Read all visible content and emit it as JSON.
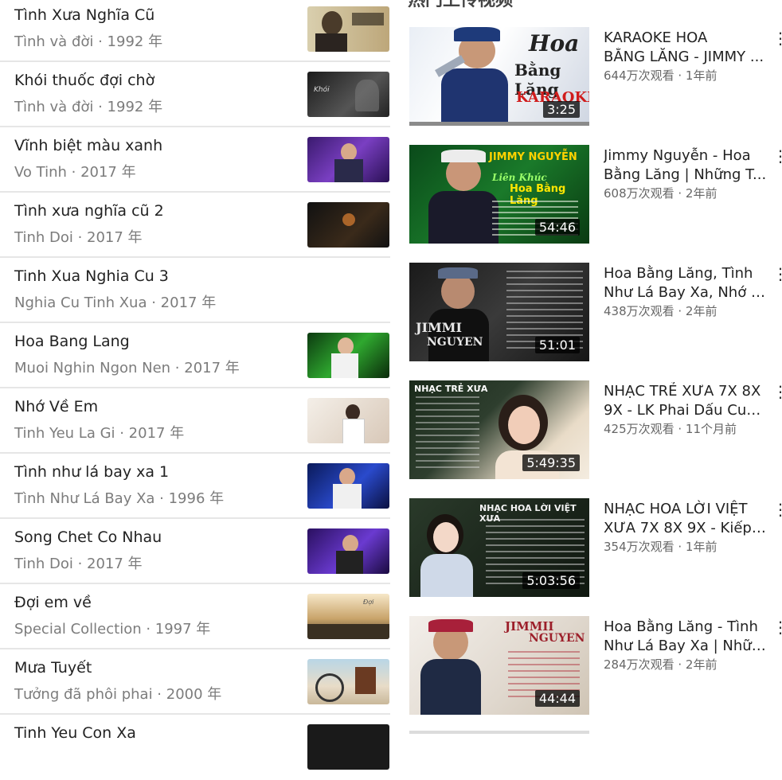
{
  "section_title": "热门上传视频",
  "songs": [
    {
      "title": "Tình Xưa Nghĩa Cũ",
      "subtitle": "Tình và đời · 1992 年",
      "thumb": "acoustic"
    },
    {
      "title": "Khói thuốc đợi chờ",
      "subtitle": "Tình và đời · 1992 年",
      "thumb": "dark-smoke"
    },
    {
      "title": "Vĩnh biệt màu xanh",
      "subtitle": "Vo Tinh · 2017 年",
      "thumb": "purple-stage"
    },
    {
      "title": "Tình xưa nghĩa cũ 2",
      "subtitle": "Tinh Doi · 2017 年",
      "thumb": "dark-club"
    },
    {
      "title": "Tinh Xua Nghia Cu 3",
      "subtitle": "Nghia Cu Tinh Xua · 2017 年",
      "thumb": ""
    },
    {
      "title": "Hoa Bang Lang",
      "subtitle": "Muoi Nghin Ngon Nen · 2017 年",
      "thumb": "green-stage"
    },
    {
      "title": "Nhớ Về Em",
      "subtitle": "Tinh Yeu La Gi · 2017 年",
      "thumb": "light-lady"
    },
    {
      "title": "Tình như lá bay xa 1",
      "subtitle": "Tình Như Lá Bay Xa · 1996 年",
      "thumb": "blue-stage"
    },
    {
      "title": "Song Chet Co Nhau",
      "subtitle": "Tinh Doi · 2017 年",
      "thumb": "violet-stage"
    },
    {
      "title": "Đợi em về",
      "subtitle": "Special Collection · 1997 年",
      "thumb": "sunset"
    },
    {
      "title": "Mưa Tuyết",
      "subtitle": "Tưởng đã phôi phai · 2000 年",
      "thumb": "beach"
    },
    {
      "title": "Tinh Yeu Con Xa",
      "subtitle": "",
      "thumb": "dark-club"
    }
  ],
  "videos": [
    {
      "title_line1": "KARAOKE HOA",
      "title_line2": "BẰNG LĂNG - JIMMY ...",
      "meta": "644万次观看 · 1年前",
      "duration": "3:25",
      "thumb_text1": "Hoa",
      "thumb_text2": "Bằng Lăng",
      "thumb_text3": "KARAOKE"
    },
    {
      "title_line1": "Jimmy Nguyễn - Hoa",
      "title_line2": "Bằng Lăng | Những T...",
      "meta": "608万次观看 · 2年前",
      "duration": "54:46",
      "thumb_text1": "JIMMY NGUYỄN",
      "thumb_text2": "Liên Khúc",
      "thumb_text3": "Hoa Bằng Lăng"
    },
    {
      "title_line1": "Hoa Bằng Lăng, Tình",
      "title_line2": "Như Lá Bay Xa, Nhớ V...",
      "meta": "438万次观看 · 2年前",
      "duration": "51:01",
      "thumb_text1": "JIMMI",
      "thumb_text2": "NGUYEN",
      "thumb_text3": ""
    },
    {
      "title_line1": "NHẠC TRẺ XƯA 7X 8X",
      "title_line2": "9X - LK Phai Dấu Cuộ...",
      "meta": "425万次观看 · 11个月前",
      "duration": "5:49:35",
      "thumb_text1": "NHẠC TRẺ XƯA",
      "thumb_text2": "",
      "thumb_text3": ""
    },
    {
      "title_line1": "NHẠC HOA LỜI VIỆT",
      "title_line2": "XƯA 7X 8X 9X - Kiếp ...",
      "meta": "354万次观看 · 1年前",
      "duration": "5:03:56",
      "thumb_text1": "NHẠC HOA LỜI VIỆT XƯA",
      "thumb_text2": "",
      "thumb_text3": ""
    },
    {
      "title_line1": "Hoa Bằng Lăng - Tình",
      "title_line2": "Như Lá Bay Xa | Nhữn...",
      "meta": "284万次观看 · 2年前",
      "duration": "44:44",
      "thumb_text1": "JIMMII",
      "thumb_text2": "NGUYEN",
      "thumb_text3": ""
    }
  ],
  "icons": {
    "more": "more-vert-icon"
  },
  "colors": {
    "divider": "#e6e6e6",
    "meta_text": "#7c7c7c",
    "duration_bg": "#000000"
  }
}
